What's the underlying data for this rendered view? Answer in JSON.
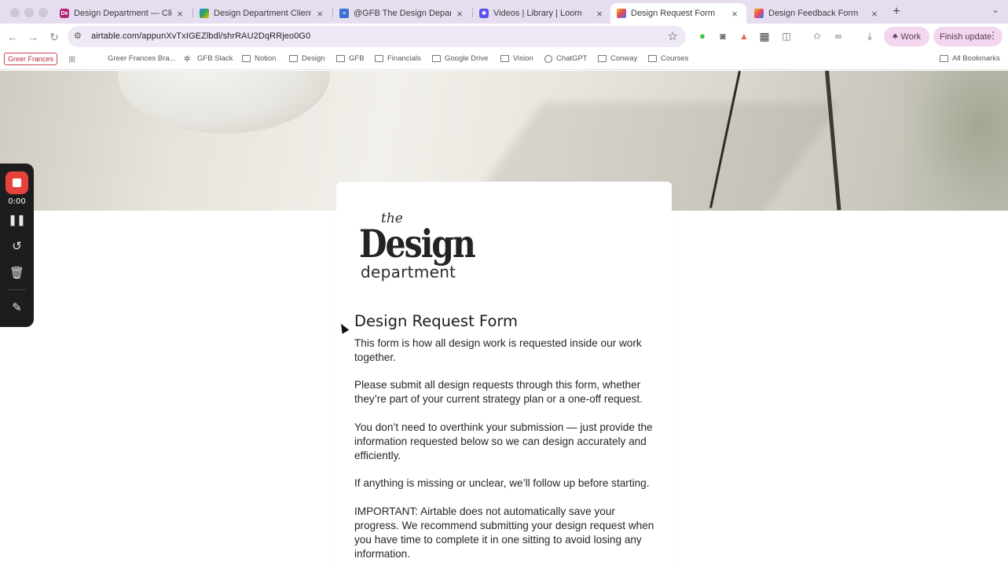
{
  "browser": {
    "tabs": [
      {
        "title": "Design Department — Client",
        "icon": "adobe-icon",
        "color": "#b0237a",
        "fav": "De"
      },
      {
        "title": "Design Department Client Re",
        "icon": "drive-icon",
        "color": "#1e88e5",
        "fav": ""
      },
      {
        "title": "@GFB The Design Departmen",
        "icon": "docs-icon",
        "color": "#3b6fd6",
        "fav": ""
      },
      {
        "title": "Videos | Library | Loom",
        "icon": "loom-icon",
        "color": "#5a4ff3",
        "fav": ""
      },
      {
        "title": "Design Request Form",
        "icon": "airtable-icon",
        "color": "#f2b312",
        "fav": ""
      },
      {
        "title": "Design Feedback Form",
        "icon": "airtable-icon",
        "color": "#f2b312",
        "fav": ""
      }
    ],
    "url": "airtable.com/appunXvTxIGEZlbdl/shrRAU2DqRRjeo0G0",
    "profile_label": "Work",
    "update_label": "Finish update",
    "bookmarks": {
      "badge": "Greer Frances",
      "items": [
        {
          "label": "Greer Frances Bra...",
          "icon": "gmail-icon"
        },
        {
          "label": "GFB Slack",
          "icon": "slack-icon"
        },
        {
          "label": "Notion",
          "icon": "folder-icon"
        },
        {
          "label": "Design",
          "icon": "folder-icon"
        },
        {
          "label": "GFB",
          "icon": "folder-icon"
        },
        {
          "label": "Financials",
          "icon": "folder-icon"
        },
        {
          "label": "Google Drive",
          "icon": "folder-icon"
        },
        {
          "label": "Vision",
          "icon": "folder-icon"
        },
        {
          "label": "ChatGPT",
          "icon": "chatgpt-icon"
        },
        {
          "label": "Conway",
          "icon": "folder-icon"
        },
        {
          "label": "Courses",
          "icon": "folder-icon"
        }
      ],
      "all_label": "All Bookmarks"
    }
  },
  "loom": {
    "time": "0:00"
  },
  "logo": {
    "the": "the",
    "design": "Design",
    "department": "department"
  },
  "form": {
    "title": "Design Request Form",
    "paragraphs": [
      "This form is how all design work is requested inside our work together.",
      "Please submit all design requests through this form, whether they’re part of your current strategy plan or a one-off request.",
      "You don’t need to overthink your submission — just provide the information requested below so we can design accurately and efficiently.",
      "If anything is missing or unclear, we’ll follow up before starting.",
      "IMPORTANT: Airtable does not automatically save your progress. We recommend submitting your design request when you have time to complete it in one sitting to avoid losing any information."
    ]
  }
}
